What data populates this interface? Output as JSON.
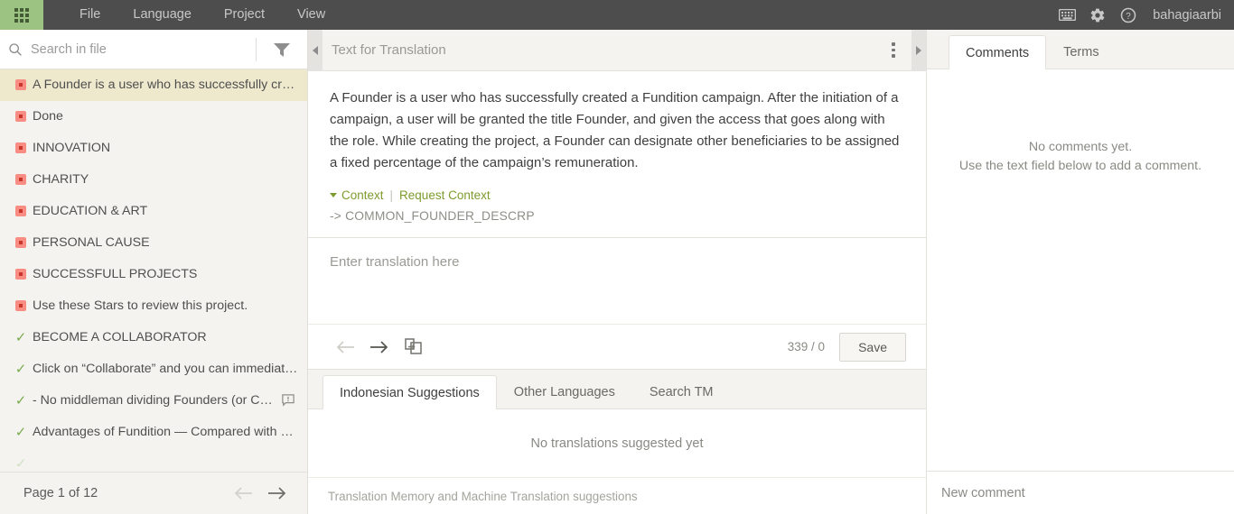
{
  "topbar": {
    "logo_icon": "app-grid-icon",
    "menu": [
      {
        "label": "File"
      },
      {
        "label": "Language"
      },
      {
        "label": "Project"
      },
      {
        "label": "View"
      }
    ],
    "icons": [
      {
        "name": "keyboard-icon"
      },
      {
        "name": "gear-icon"
      },
      {
        "name": "help-icon"
      }
    ],
    "username": "bahagiaarbi",
    "bg_color": "#4d4d4d",
    "logo_bg_color": "#9dc383"
  },
  "sidebar": {
    "search": {
      "icon": "search-icon",
      "placeholder": "Search in file",
      "value": ""
    },
    "filter_icon": "filter-funnel-icon",
    "segments": [
      {
        "label": "A Founder is a user who has successfully creat...",
        "status": "untranslated",
        "active": true,
        "has_comment": false
      },
      {
        "label": "Done",
        "status": "untranslated",
        "active": false,
        "has_comment": false
      },
      {
        "label": "INNOVATION",
        "status": "untranslated",
        "active": false,
        "has_comment": false
      },
      {
        "label": "CHARITY",
        "status": "untranslated",
        "active": false,
        "has_comment": false
      },
      {
        "label": "EDUCATION & ART",
        "status": "untranslated",
        "active": false,
        "has_comment": false
      },
      {
        "label": "PERSONAL CAUSE",
        "status": "untranslated",
        "active": false,
        "has_comment": false
      },
      {
        "label": "SUCCESSFULL PROJECTS",
        "status": "untranslated",
        "active": false,
        "has_comment": false
      },
      {
        "label": "Use these Stars to review this project.",
        "status": "untranslated",
        "active": false,
        "has_comment": false
      },
      {
        "label": "BECOME A COLLABORATOR",
        "status": "translated",
        "active": false,
        "has_comment": false
      },
      {
        "label": "Click on “Collaborate” and you can immediatel...",
        "status": "translated",
        "active": false,
        "has_comment": false
      },
      {
        "label": "- No middleman dividing Founders (or Coll...",
        "status": "translated",
        "active": false,
        "has_comment": true
      },
      {
        "label": "Advantages of Fundition — Compared with Ot...",
        "status": "translated",
        "active": false,
        "has_comment": false
      }
    ],
    "pagination": {
      "label": "Page 1 of 12",
      "prev_icon": "arrow-left-icon",
      "next_icon": "arrow-right-icon",
      "prev_enabled": false,
      "next_enabled": true
    },
    "status_colors": {
      "untranslated": "#f98c83",
      "untranslated_inner": "#c8362c",
      "translated": "#7aab4f"
    },
    "active_row_bg": "#eee8cd"
  },
  "center": {
    "collapse_left_icon": "collapse-left-icon",
    "collapse_right_icon": "collapse-right-icon",
    "title": "Text for Translation",
    "menu_icon": "more-vertical-icon",
    "source_text_before": "A Founder is a user who has successfully created a Fundition campaign. After the initiation of a campaign, a user will be granted the title Founder, and given the access that goes along with the role. While creating the project, a Founder can designate other beneficiaries to be assigned a fixed percentage of the campaign’s remuneration.",
    "source_highlight": " ",
    "context": {
      "toggle_label": "Context",
      "separator": "|",
      "request_label": "Request Context",
      "value": "-> COMMON_FOUNDER_DESCRP"
    },
    "translation": {
      "placeholder": "Enter translation here",
      "value": ""
    },
    "editbar": {
      "prev_icon": "arrow-left-icon",
      "next_icon": "arrow-right-icon",
      "copy_source_icon": "copy-source-icon",
      "counter": "339 / 0",
      "save_label": "Save"
    },
    "tabs": [
      {
        "label": "Indonesian Suggestions",
        "active": true
      },
      {
        "label": "Other Languages",
        "active": false
      },
      {
        "label": "Search TM",
        "active": false
      }
    ],
    "suggestions_empty": "No translations suggested yet",
    "suggestions_footer": "Translation Memory and Machine Translation suggestions"
  },
  "right": {
    "tabs": [
      {
        "label": "Comments",
        "active": true
      },
      {
        "label": "Terms",
        "active": false
      }
    ],
    "empty_line1": "No comments yet.",
    "empty_line2": "Use the text field below to add a comment.",
    "new_comment_placeholder": "New comment",
    "new_comment_value": ""
  }
}
